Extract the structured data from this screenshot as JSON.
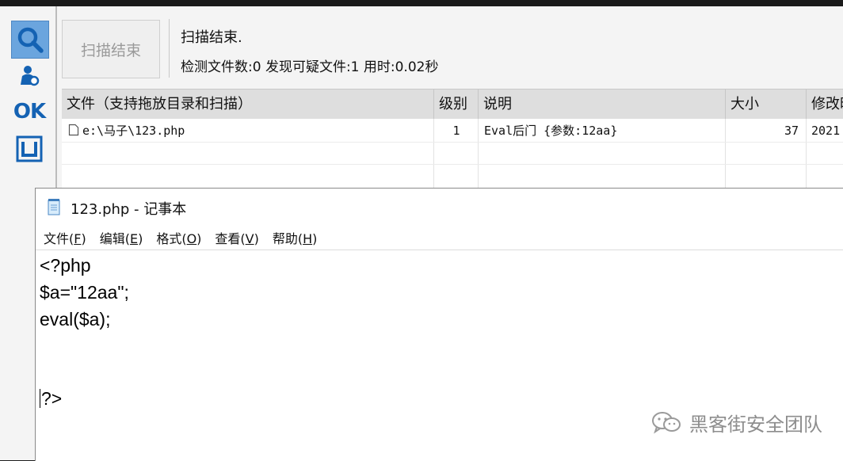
{
  "scanner": {
    "sidebar": {
      "search_icon": "search-icon",
      "user_icon": "user-icon",
      "ok_label": "OK",
      "box_icon": "box-icon"
    },
    "scan_button_label": "扫描结束",
    "status_title": "扫描结束.",
    "status_detail": "检测文件数:0 发现可疑文件:1 用时:0.02秒",
    "table": {
      "columns": [
        "文件（支持拖放目录和扫描）",
        "级别",
        "说明",
        "大小",
        "修改时"
      ],
      "rows": [
        {
          "file": "e:\\马子\\123.php",
          "level": "1",
          "description": "Eval后门 {参数:12aa}",
          "size": "37",
          "modified": "2021"
        }
      ]
    }
  },
  "notepad": {
    "title": "123.php - 记事本",
    "menu": [
      {
        "label": "文件(",
        "key": "F",
        "suffix": ")"
      },
      {
        "label": "编辑(",
        "key": "E",
        "suffix": ")"
      },
      {
        "label": "格式(",
        "key": "O",
        "suffix": ")"
      },
      {
        "label": "查看(",
        "key": "V",
        "suffix": ")"
      },
      {
        "label": "帮助(",
        "key": "H",
        "suffix": ")"
      }
    ],
    "lines": [
      "<?php",
      "$a=\"12aa\";",
      "eval($a);",
      "?>"
    ]
  },
  "watermark": {
    "icon": "wechat-icon",
    "text": "黑客街安全团队"
  },
  "colors": {
    "accent_blue": "#1462b3",
    "search_button_bg": "#6ba5de",
    "header_bg": "#dedede"
  }
}
